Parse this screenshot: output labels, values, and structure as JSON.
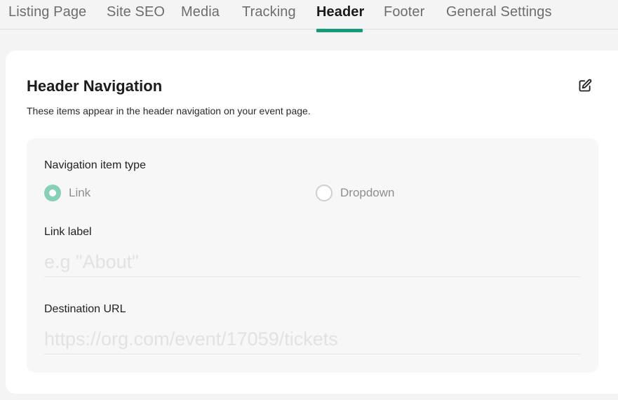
{
  "tabs": [
    {
      "label": "Listing Page",
      "active": false
    },
    {
      "label": "Site SEO",
      "active": false
    },
    {
      "label": "Media",
      "active": false
    },
    {
      "label": "Tracking",
      "active": false
    },
    {
      "label": "Header",
      "active": true
    },
    {
      "label": "Footer",
      "active": false
    },
    {
      "label": "General Settings",
      "active": false
    }
  ],
  "colors": {
    "accent": "#159a7c",
    "radio_checked": "#86d0b9",
    "page_bg": "#f4f4f4",
    "panel_bg": "#f7f7f7"
  },
  "card": {
    "title": "Header Navigation",
    "description": "These items appear in the header navigation on your event page.",
    "edit_icon": "edit-icon"
  },
  "form": {
    "item_type_label": "Navigation item type",
    "options": [
      {
        "label": "Link",
        "checked": true
      },
      {
        "label": "Dropdown",
        "checked": false
      }
    ],
    "link_label": {
      "label": "Link label",
      "value": "",
      "placeholder": "e.g \"About\""
    },
    "destination_url": {
      "label": "Destination URL",
      "value": "",
      "placeholder": "https://org.com/event/17059/tickets"
    }
  }
}
